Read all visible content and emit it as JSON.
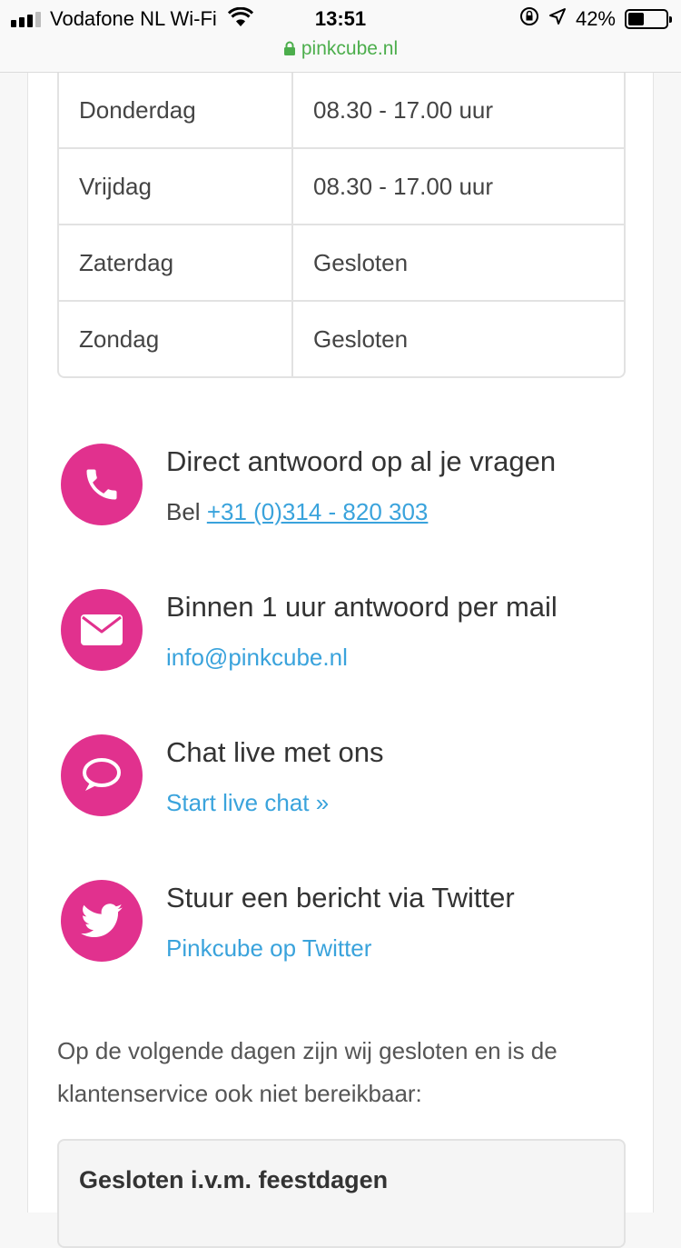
{
  "status_bar": {
    "carrier": "Vodafone NL Wi-Fi",
    "time": "13:51",
    "battery": "42%",
    "battery_level": 0.42,
    "url": "pinkcube.nl"
  },
  "hours": [
    {
      "day": "Donderdag",
      "time": "08.30 - 17.00 uur"
    },
    {
      "day": "Vrijdag",
      "time": "08.30 - 17.00 uur"
    },
    {
      "day": "Zaterdag",
      "time": "Gesloten"
    },
    {
      "day": "Zondag",
      "time": "Gesloten"
    }
  ],
  "contacts": {
    "phone": {
      "title": "Direct antwoord op al je vragen",
      "prefix": "Bel",
      "link": "+31 (0)314 - 820 303",
      "icon": "phone-icon"
    },
    "mail": {
      "title": "Binnen 1 uur antwoord per mail",
      "link": "info@pinkcube.nl",
      "icon": "envelope-icon"
    },
    "chat": {
      "title": "Chat live met ons",
      "link": "Start live chat »",
      "icon": "chat-bubble-icon"
    },
    "twitter": {
      "title": "Stuur een bericht via Twitter",
      "link": "Pinkcube op Twitter",
      "icon": "twitter-bird-icon"
    }
  },
  "closed_notice": "Op de volgende dagen zijn wij gesloten en is de klantenservice ook niet bereikbaar:",
  "holiday_box": {
    "title": "Gesloten i.v.m. feestdagen"
  },
  "colors": {
    "accent": "#e1318e",
    "link": "#3aa3dc",
    "secure": "#4cae4c"
  }
}
